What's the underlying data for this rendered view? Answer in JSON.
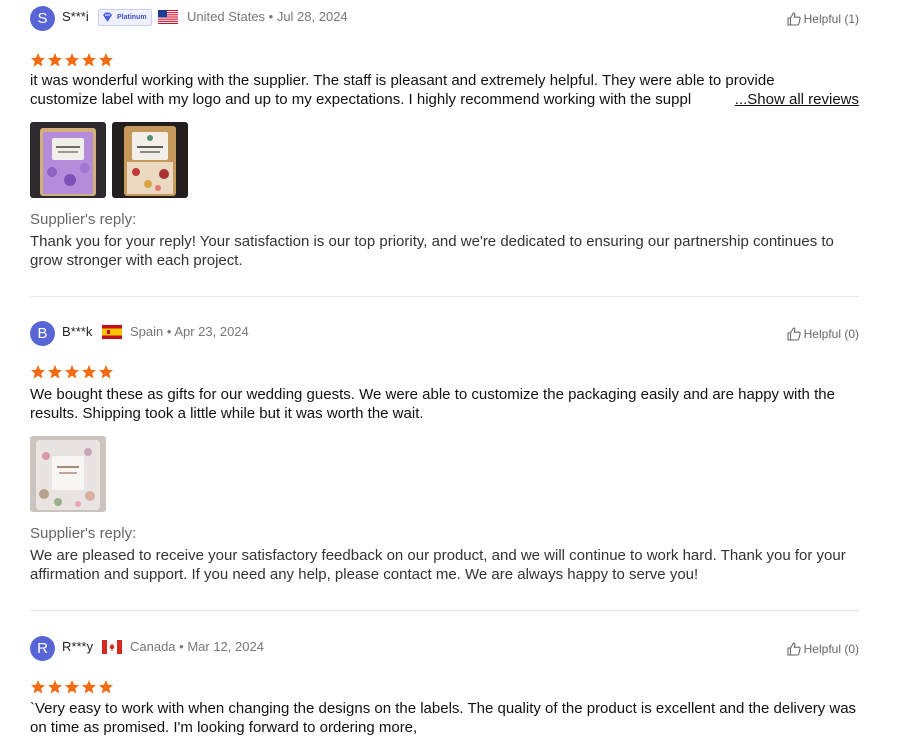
{
  "reviews": [
    {
      "initial": "S",
      "name": "S***i",
      "badge": "Platinum",
      "country": "United States",
      "date": "Jul 28, 2024",
      "helpful": "Helpful (1)",
      "rating": 5,
      "text_line1": "it was wonderful working with the supplier. The staff is pleasant and extremely helpful. They were able to provide",
      "text_line2": "customize label with my logo and up to my expectations. I highly recommend working with the suppl",
      "show_all": "...Show all reviews",
      "reply_label": "Supplier's reply:",
      "reply_text": "Thank you for your reply! Your satisfaction is our top priority, and we're dedicated to ensuring our partnership continues to grow stronger with each project."
    },
    {
      "initial": "B",
      "name": "B***k",
      "country": "Spain",
      "date": "Apr 23, 2024",
      "helpful": "Helpful (0)",
      "rating": 5,
      "text": "We bought these as gifts for our wedding guests. We were able to customize the packaging easily and are happy with the results. Shipping took a little while but it was worth the wait.",
      "reply_label": "Supplier's reply:",
      "reply_text": "We are pleased to receive your satisfactory feedback on our product, and we will continue to work hard. Thank you for your affirmation and support. If you need any help, please contact me. We are always happy to serve you!"
    },
    {
      "initial": "R",
      "name": "R***y",
      "country": "Canada",
      "date": "Mar 12, 2024",
      "helpful": "Helpful (0)",
      "rating": 5,
      "text": "`Very easy to work with when changing the designs on the labels. The quality of the product is excellent and the delivery was on time as promised. I'm looking forward to ordering more,"
    }
  ],
  "colors": {
    "star": "#f36b12",
    "avatar": "#5865d6",
    "divider": "#e6e6e6"
  }
}
